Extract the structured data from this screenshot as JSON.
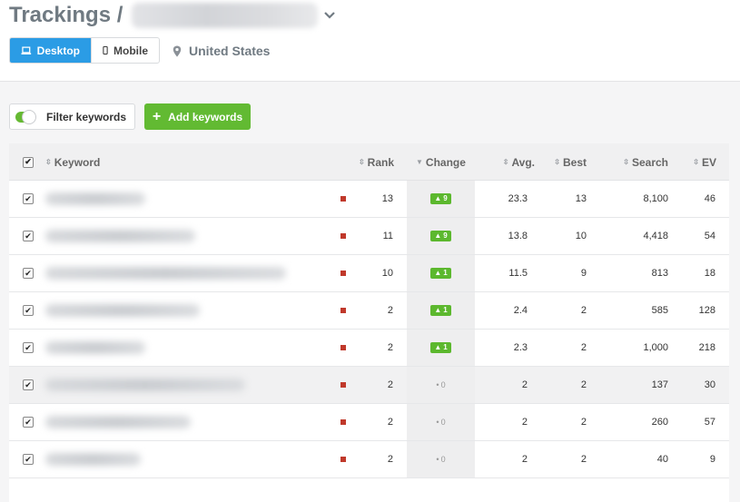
{
  "header": {
    "title": "Trackings /"
  },
  "devices": {
    "desktop_label": "Desktop",
    "mobile_label": "Mobile"
  },
  "location": {
    "label": "United States"
  },
  "toolbar": {
    "filter_label": "Filter keywords",
    "add_label": "Add keywords"
  },
  "columns": {
    "keyword": "Keyword",
    "rank": "Rank",
    "change": "Change",
    "avg": "Avg.",
    "best": "Best",
    "search": "Search",
    "ev": "EV"
  },
  "colors": {
    "accent_blue": "#2b9ce5",
    "accent_green": "#62ba32",
    "rank_marker": "#c0392b"
  },
  "rows": [
    {
      "rank": "13",
      "change": "9",
      "change_dir": "up",
      "avg": "23.3",
      "best": "13",
      "search": "8,100",
      "ev": "46",
      "kw_width": 110
    },
    {
      "rank": "11",
      "change": "9",
      "change_dir": "up",
      "avg": "13.8",
      "best": "10",
      "search": "4,418",
      "ev": "54",
      "kw_width": 165
    },
    {
      "rank": "10",
      "change": "1",
      "change_dir": "up",
      "avg": "11.5",
      "best": "9",
      "search": "813",
      "ev": "18",
      "kw_width": 265
    },
    {
      "rank": "2",
      "change": "1",
      "change_dir": "up",
      "avg": "2.4",
      "best": "2",
      "search": "585",
      "ev": "128",
      "kw_width": 170
    },
    {
      "rank": "2",
      "change": "1",
      "change_dir": "up",
      "avg": "2.3",
      "best": "2",
      "search": "1,000",
      "ev": "218",
      "kw_width": 110
    },
    {
      "rank": "2",
      "change": "0",
      "change_dir": "none",
      "avg": "2",
      "best": "2",
      "search": "137",
      "ev": "30",
      "kw_width": 220
    },
    {
      "rank": "2",
      "change": "0",
      "change_dir": "none",
      "avg": "2",
      "best": "2",
      "search": "260",
      "ev": "57",
      "kw_width": 160
    },
    {
      "rank": "2",
      "change": "0",
      "change_dir": "none",
      "avg": "2",
      "best": "2",
      "search": "40",
      "ev": "9",
      "kw_width": 105
    }
  ]
}
